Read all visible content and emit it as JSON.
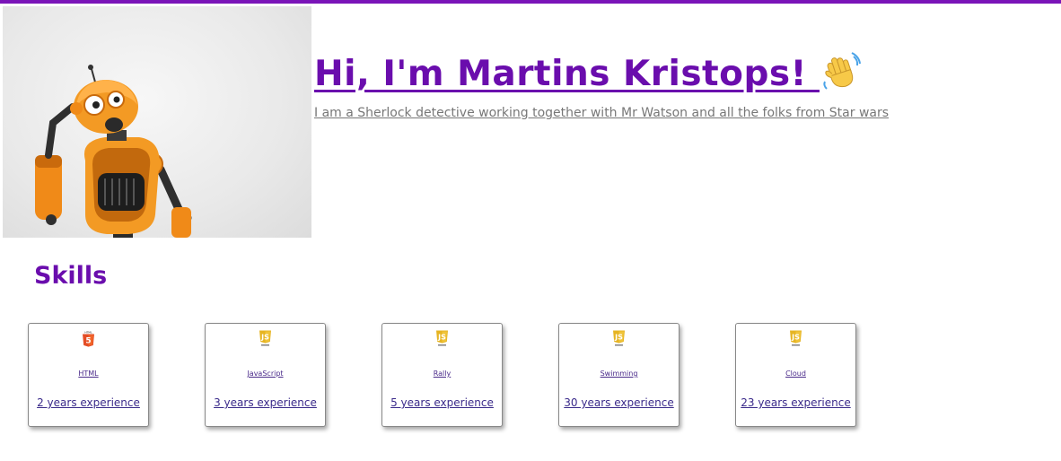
{
  "header": {
    "title": "Hi, I'm Martins Kristops! ",
    "subtitle": "I am a Sherlock detective working together with Mr Watson and all the folks from Star wars"
  },
  "skills_section": {
    "title": "Skills"
  },
  "skills": [
    {
      "name": "HTML",
      "experience": "2 years experience",
      "icon": "html5-icon"
    },
    {
      "name": "JavaScript",
      "experience": "3 years experience",
      "icon": "javascript-icon"
    },
    {
      "name": "Rally",
      "experience": "5 years experience",
      "icon": "javascript-icon"
    },
    {
      "name": "Swimming",
      "experience": "30 years experience",
      "icon": "javascript-icon"
    },
    {
      "name": "Cloud",
      "experience": "23 years experience",
      "icon": "javascript-icon"
    }
  ],
  "colors": {
    "accent": "#6a0dad",
    "top_bar": "#7a14b8",
    "html5": "#e44d26",
    "javascript": "#e6b422"
  }
}
